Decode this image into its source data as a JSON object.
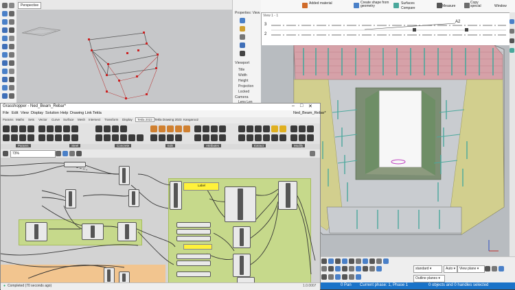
{
  "rhino": {
    "viewport_tab": "Perspective",
    "props": {
      "header": "Properties: View",
      "section": "Viewport",
      "rows": [
        "Title",
        "Width",
        "Height",
        "Projection",
        "Locked"
      ],
      "camera": "Camera",
      "lens": "Lens Len"
    }
  },
  "grasshopper": {
    "title": "Grasshopper - Ned_Beam_Rebar*",
    "doc_name": "Ned_Beam_Rebar*",
    "menu": [
      "File",
      "Edit",
      "View",
      "Display",
      "Solution",
      "Help",
      "Drawing Link",
      "Tekla"
    ],
    "tabs": [
      "Params",
      "Maths",
      "Sets",
      "Vector",
      "Curve",
      "Surface",
      "Mesh",
      "Intersect",
      "Transform",
      "Display",
      "Tekla 2023",
      "Tekla Drawing 2023",
      "Kangaroo2"
    ],
    "active_tab": "Tekla 2023",
    "categories": [
      "Params",
      "Steel",
      "Concrete",
      "Edit",
      "Attributes",
      "Extract",
      "Modify"
    ],
    "zoom": "73%",
    "status": "Completed (70 seconds ago)",
    "version": "1.0.0007",
    "panel_text": "Label"
  },
  "tekla": {
    "ribbon": {
      "added_material": "Added material",
      "create_shape": "Create shape from geometry",
      "surfaces": "Surfaces",
      "compare": "Compare",
      "measure": "Measure",
      "copy_special": "Copy special",
      "window": "Window"
    },
    "drawing": {
      "tab": "View 1 - 1",
      "row3": "3",
      "row2": "2",
      "tag_a2": "A2"
    },
    "bottombar": {
      "standard": "standard",
      "auto": "Auto",
      "view_plane": "View plane",
      "outline_planes": "Outline planes"
    },
    "status": {
      "pan": "0  Pan",
      "phase": "Current phase: 1, Phase 1",
      "selection": "0 objects and 0 handles selected"
    }
  },
  "colors": {
    "rebar_teal": "#4aa89c",
    "tekla_status_blue": "#1a73c8",
    "gh_group_green": "#c6d98b",
    "gh_group_orange": "#f2c58f",
    "rhino_point_red": "#cc2222"
  }
}
